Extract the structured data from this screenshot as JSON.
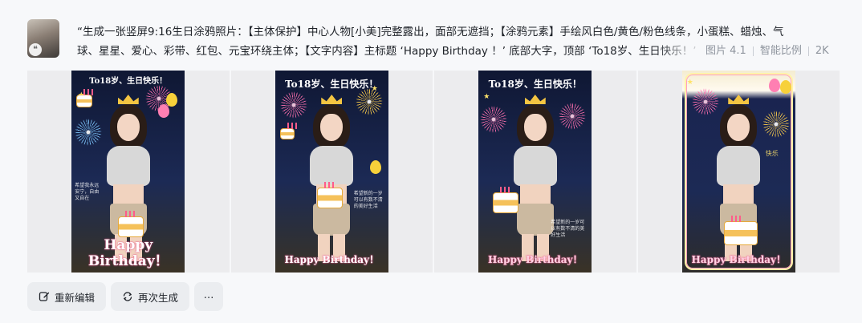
{
  "prompt": {
    "line1": "“生成一张竖屏9:16生日涂鸦照片：【主体保护】中心人物[小美]完整露出，面部无遮挡；【涂鸦元素】手绘风白色/黄色/粉色线条，小蛋糕、蜡烛、气",
    "line2": "球、星星、爱心、彩带、红包、元宝环绕主体；【文字内容】主标题 ‘Happy Birthday ！’ 底部大字，顶部 ‘To18岁、生日快乐！’",
    "model": "图片 4.1",
    "ratio": "智能比例",
    "resolution": "2K"
  },
  "images": [
    {
      "top_text": "To18岁、生日快乐！",
      "bottom_text_line1": "Happy",
      "bottom_text_line2": "Birthday！",
      "note": "希望我永远安宁，自由又自在"
    },
    {
      "top_text": "To18岁、生日快乐！",
      "bottom_text": "Happy Birthday！",
      "note": "希望新的一岁可以有数不清的美好生活"
    },
    {
      "top_text": "To18岁、生日快乐！",
      "bottom_text": "Happy Birthday！",
      "note": "希望新的一岁可以有数不清的美好生活"
    },
    {
      "top_text": "",
      "bottom_text": "Happy Birthday！",
      "note": "快乐"
    }
  ],
  "actions": {
    "reedit": "重新编辑",
    "regenerate": "再次生成",
    "more": "⋯"
  },
  "colors": {
    "background": "#f7f8fa",
    "button": "#ebedf0",
    "meta_text": "#8f959e"
  }
}
